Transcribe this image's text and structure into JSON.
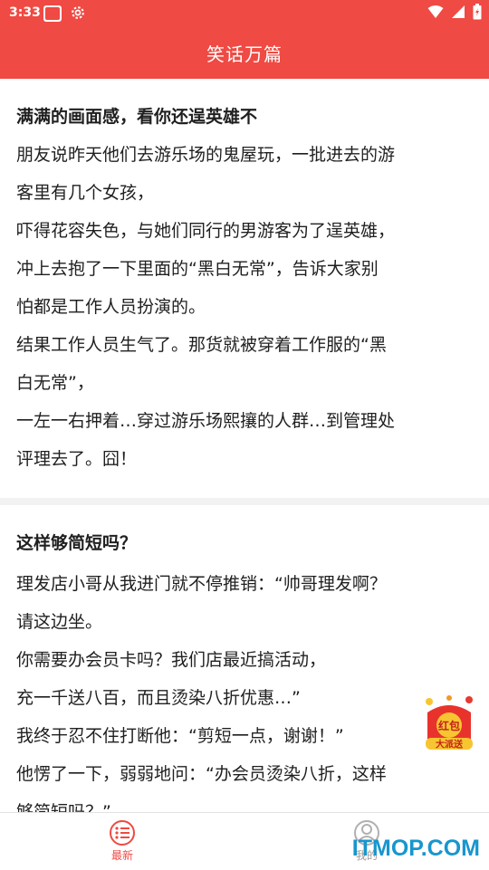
{
  "status_bar": {
    "time": "3:33"
  },
  "app_title": "笑话万篇",
  "jokes": [
    {
      "title": "满满的画面感，看你还逞英雄不",
      "lines": [
        "朋友说昨天他们去游乐场的鬼屋玩，一批进去的游",
        "客里有几个女孩，",
        "吓得花容失色，与她们同行的男游客为了逞英雄，",
        "冲上去抱了一下里面的“黑白无常”，告诉大家别",
        "怕都是工作人员扮演的。",
        "结果工作人员生气了。那货就被穿着工作服的“黑",
        "白无常”，",
        "一左一右押着…穿过游乐场熙攘的人群…到管理处",
        "评理去了。囧！"
      ]
    },
    {
      "title": "这样够简短吗？",
      "lines": [
        "理发店小哥从我进门就不停推销：“帅哥理发啊？",
        "请这边坐。",
        "你需要办会员卡吗？我们店最近搞活动，",
        "充一千送八百，而且烫染八折优惠…”",
        "我终于忍不住打断他：“剪短一点，谢谢！”",
        "他愣了一下，弱弱地问：“办会员烫染八折，这样",
        "够简短吗？”"
      ]
    }
  ],
  "floating_badge": {
    "line1": "红包",
    "line2": "大派送"
  },
  "bottom_nav": {
    "latest_label": "最新",
    "mine_label": "我的"
  },
  "watermark": "ITMOP.COM",
  "colors": {
    "primary": "#ef4a43",
    "inactive": "#9c9c9c",
    "watermark": "#1796ce"
  }
}
